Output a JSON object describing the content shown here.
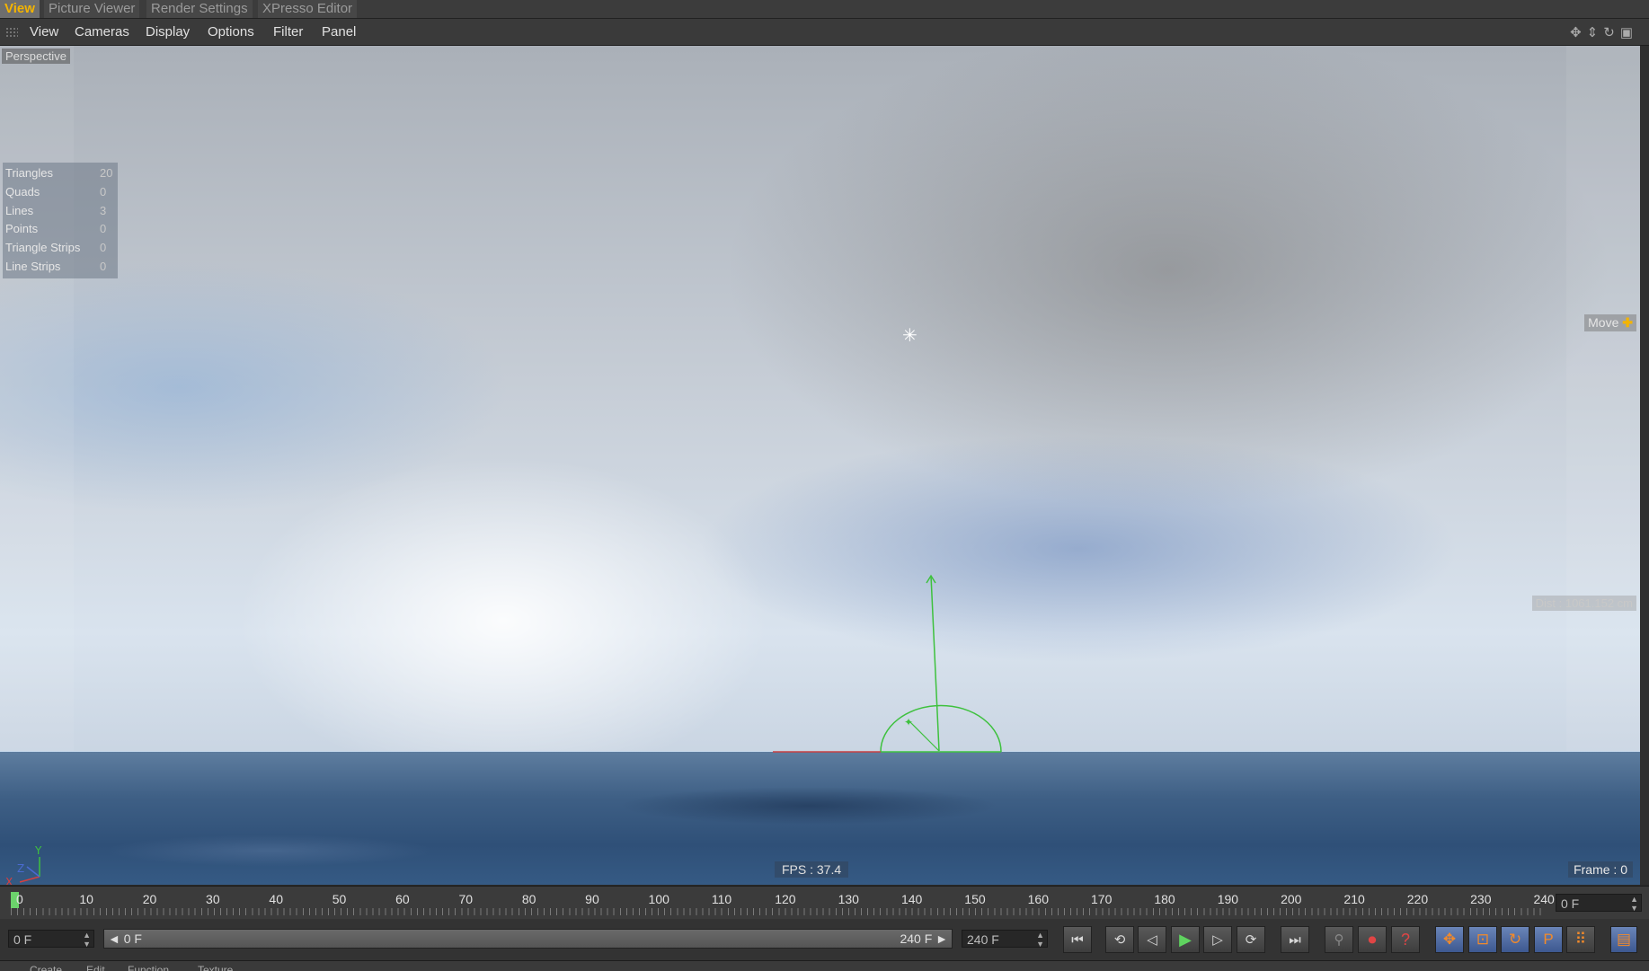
{
  "tabs": [
    {
      "label": "View",
      "active": true
    },
    {
      "label": "Picture Viewer",
      "active": false
    },
    {
      "label": "Render Settings",
      "active": false
    },
    {
      "label": "XPresso Editor",
      "active": false
    }
  ],
  "menu": [
    "View",
    "Cameras",
    "Display",
    "Options",
    "Filter",
    "Panel"
  ],
  "nav_icons": [
    "move-view-icon",
    "dolly-icon",
    "rotate-view-icon",
    "maximize-icon"
  ],
  "viewport": {
    "camera_label": "Perspective",
    "stats": [
      {
        "label": "Triangles",
        "value": "20"
      },
      {
        "label": "Quads",
        "value": "0"
      },
      {
        "label": "Lines",
        "value": "3"
      },
      {
        "label": "Points",
        "value": "0"
      },
      {
        "label": "Triangle Strips",
        "value": "0"
      },
      {
        "label": "Line Strips",
        "value": "0"
      }
    ],
    "hud_move": "Move",
    "dist": "Dist : 1061.152 cm",
    "fps": "FPS : 37.4",
    "frame": "Frame : 0",
    "axis": {
      "x": "X",
      "y": "Y",
      "z": "Z"
    }
  },
  "timeline": {
    "ticks": [
      "0",
      "10",
      "20",
      "30",
      "40",
      "50",
      "60",
      "70",
      "80",
      "90",
      "100",
      "110",
      "120",
      "130",
      "140",
      "150",
      "160",
      "170",
      "180",
      "190",
      "200",
      "210",
      "220",
      "230",
      "240"
    ],
    "current_frame_field": "0 F"
  },
  "controls": {
    "start_field": "0 F",
    "range_start": "◄ 0 F",
    "range_end": "240 F ►",
    "end_field": "240 F",
    "transport": [
      {
        "name": "go-to-start-button",
        "glyph": "⏮"
      },
      {
        "name": "previous-key-button",
        "glyph": "⟲"
      },
      {
        "name": "step-back-button",
        "glyph": "◁"
      },
      {
        "name": "play-button",
        "glyph": "▶"
      },
      {
        "name": "step-forward-button",
        "glyph": "▷"
      },
      {
        "name": "next-key-button",
        "glyph": "⟳"
      },
      {
        "name": "go-to-end-button",
        "glyph": "⏭"
      }
    ],
    "record": [
      {
        "name": "keyframe-selection-button",
        "glyph": "⚲"
      },
      {
        "name": "record-active-objects-button",
        "glyph": "⏺"
      },
      {
        "name": "autokeying-button",
        "glyph": "?"
      }
    ],
    "keys": [
      {
        "name": "record-position-button",
        "glyph": "✥"
      },
      {
        "name": "record-scale-button",
        "glyph": "⊡"
      },
      {
        "name": "record-rotation-button",
        "glyph": "↻"
      },
      {
        "name": "record-parameter-button",
        "glyph": "P"
      },
      {
        "name": "record-point-level-button",
        "glyph": "⠿"
      }
    ],
    "timeline_button": "▤"
  },
  "bottom_menu": [
    "Create",
    "Edit",
    "Function",
    "Texture"
  ]
}
